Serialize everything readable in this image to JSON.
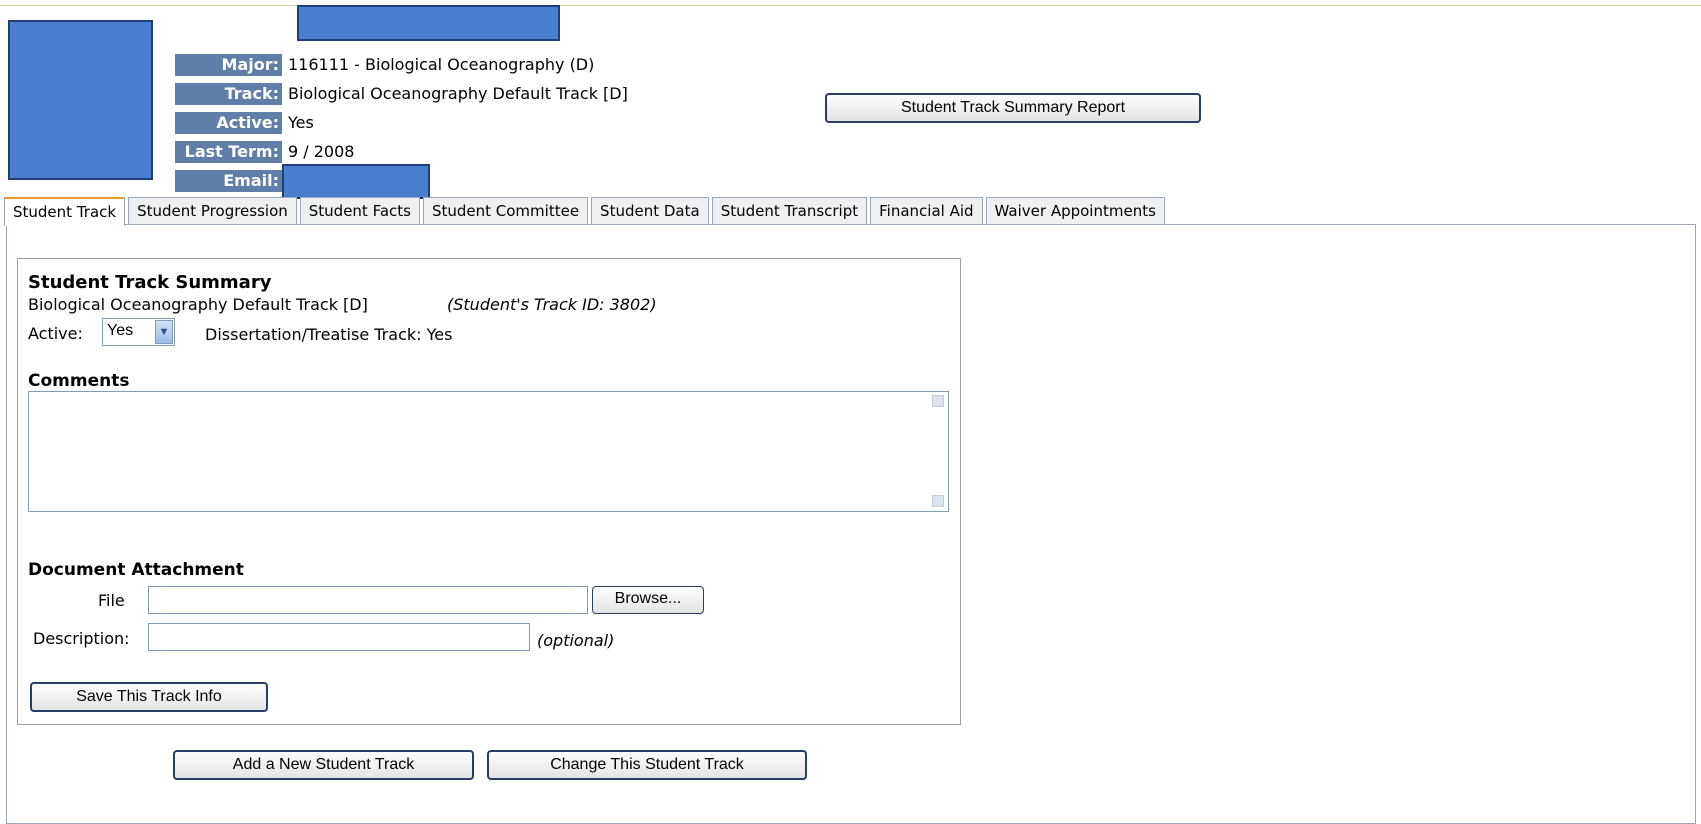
{
  "header": {
    "major_label": "Major:",
    "major_value": "116111 - Biological Oceanography (D)",
    "track_label": "Track:",
    "track_value": "Biological Oceanography Default Track [D]",
    "active_label": "Active:",
    "active_value": "Yes",
    "last_term_label": "Last Term:",
    "last_term_value": "9 / 2008",
    "email_label": "Email:",
    "summary_report_button": "Student Track Summary Report"
  },
  "tabs": [
    {
      "label": "Student Track",
      "active": true
    },
    {
      "label": "Student Progression",
      "active": false
    },
    {
      "label": "Student Facts",
      "active": false
    },
    {
      "label": "Student Committee",
      "active": false
    },
    {
      "label": "Student Data",
      "active": false
    },
    {
      "label": "Student Transcript",
      "active": false
    },
    {
      "label": "Financial Aid",
      "active": false
    },
    {
      "label": "Waiver Appointments",
      "active": false
    }
  ],
  "summary": {
    "heading": "Student Track Summary",
    "track_name": "Biological Oceanography Default Track [D]",
    "track_id_note": "(Student's Track ID: 3802)",
    "active_label": "Active:",
    "active_selected": "Yes",
    "dissertation_text": "Dissertation/Treatise Track: Yes",
    "comments_heading": "Comments",
    "comments_value": ""
  },
  "attachment": {
    "heading": "Document Attachment",
    "file_label": "File",
    "file_value": "",
    "browse_button": "Browse...",
    "description_label": "Description:",
    "description_value": "",
    "optional_note": "(optional)"
  },
  "actions": {
    "save_button": "Save This Track Info",
    "add_button": "Add a New Student Track",
    "change_button": "Change This Student Track"
  },
  "colors": {
    "redaction": "#4a7fd0",
    "label_bg": "#5f7fa8",
    "active_tab_accent": "#e89a2a"
  }
}
